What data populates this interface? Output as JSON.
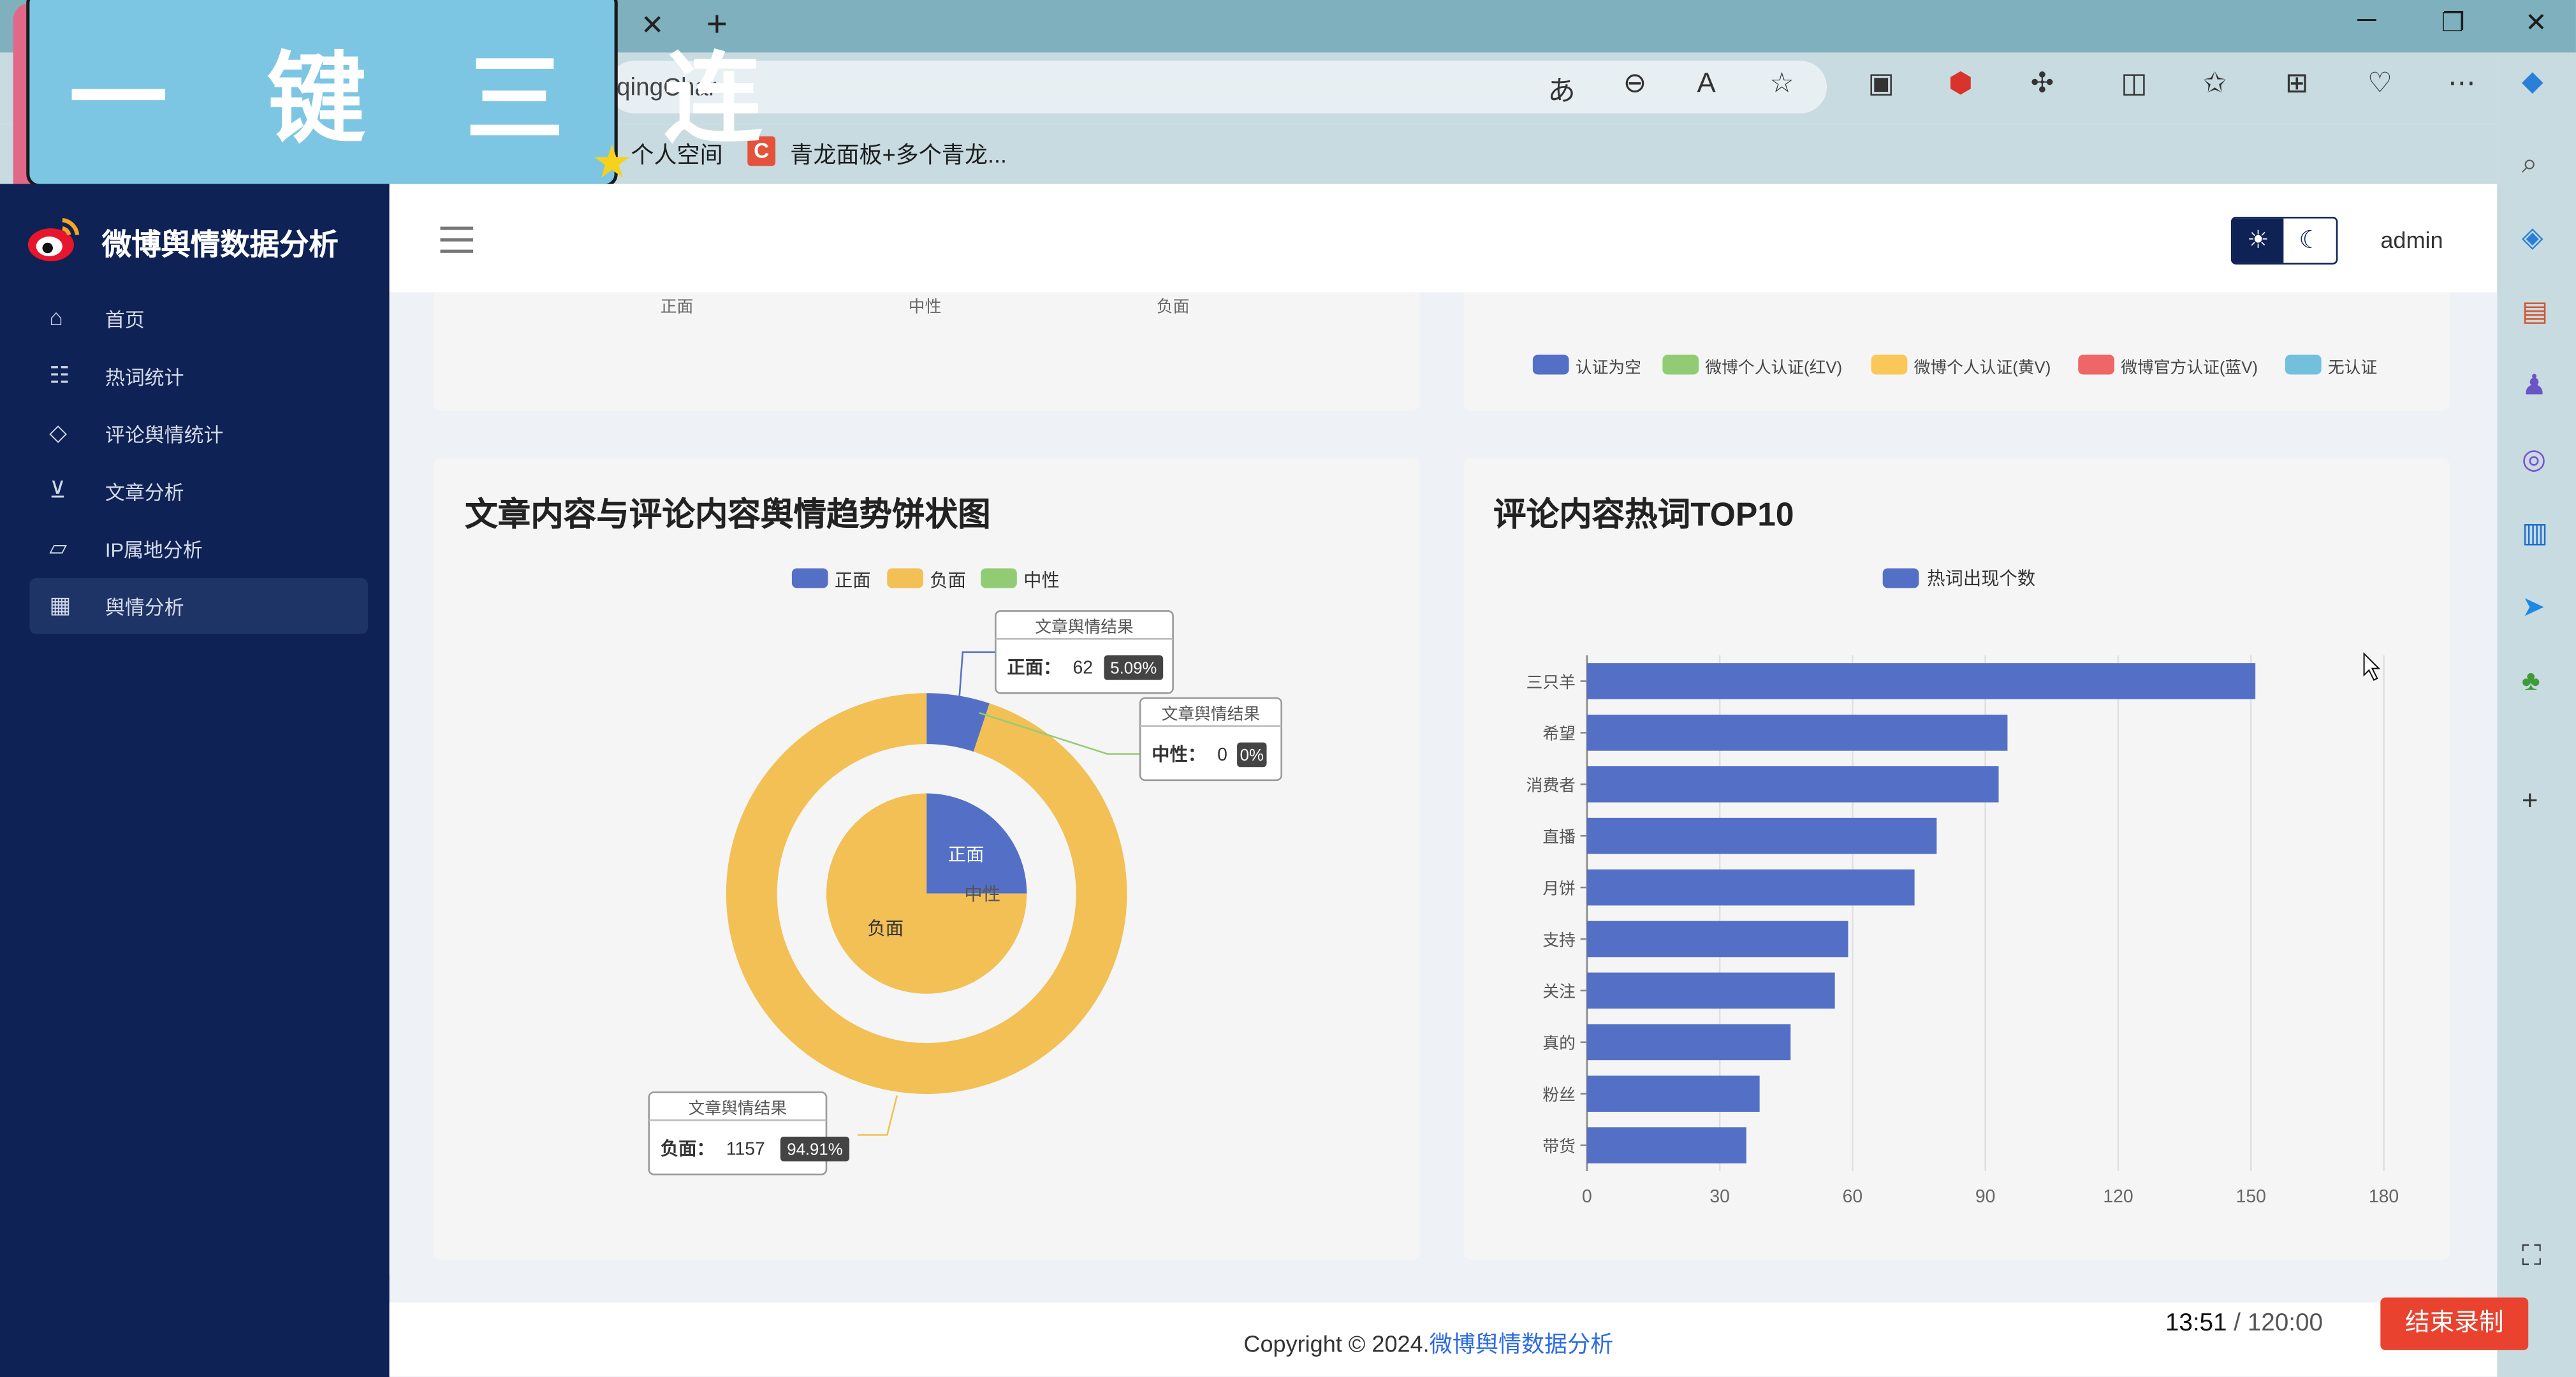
{
  "overlay": {
    "banner_text": "一 键 三 连"
  },
  "browser": {
    "url_fragment": "iqingChar",
    "bookmarks": [
      {
        "label": "个人空间"
      },
      {
        "label": "青龙面板+多个青龙..."
      }
    ],
    "bookmark_icon_letter": "C"
  },
  "app": {
    "title": "微博舆情数据分析",
    "user": "admin",
    "nav": [
      {
        "label": "首页",
        "icon": "home-icon",
        "active": false
      },
      {
        "label": "热词统计",
        "icon": "people-icon",
        "active": false
      },
      {
        "label": "评论舆情统计",
        "icon": "tag-icon",
        "active": false
      },
      {
        "label": "文章分析",
        "icon": "cart-icon",
        "active": false
      },
      {
        "label": "IP属地分析",
        "icon": "chart-icon",
        "active": false
      },
      {
        "label": "舆情分析",
        "icon": "calendar-icon",
        "active": true
      }
    ]
  },
  "top_cards": {
    "left_axis_labels": [
      "正面",
      "中性",
      "负面"
    ],
    "right_legend": [
      {
        "name": "认证为空",
        "color": "#5470c6"
      },
      {
        "name": "微博个人认证(红V)",
        "color": "#91cc75"
      },
      {
        "name": "微博个人认证(黄V)",
        "color": "#fac858"
      },
      {
        "name": "微博官方认证(蓝V)",
        "color": "#ee6666"
      },
      {
        "name": "无认证",
        "color": "#73c0de"
      }
    ]
  },
  "chart_data": [
    {
      "type": "pie",
      "title": "文章内容与评论内容舆情趋势饼状图",
      "legend": [
        {
          "name": "正面",
          "color": "#5470c6"
        },
        {
          "name": "负面",
          "color": "#f2c055"
        },
        {
          "name": "中性",
          "color": "#91cc75"
        }
      ],
      "outer_ring": {
        "slices": [
          {
            "name": "正面",
            "value": 62,
            "percent": "5.09%",
            "color": "#5470c6"
          },
          {
            "name": "中性",
            "value": 0,
            "percent": "0%",
            "color": "#91cc75"
          },
          {
            "name": "负面",
            "value": 1157,
            "percent": "94.91%",
            "color": "#f2c055"
          }
        ]
      },
      "inner_pie": {
        "slices": [
          {
            "name": "正面",
            "fraction": 0.25,
            "color": "#5470c6"
          },
          {
            "name": "中性",
            "fraction": 0.0,
            "color": "#91cc75"
          },
          {
            "name": "负面",
            "fraction": 0.75,
            "color": "#f2c055"
          }
        ]
      },
      "tooltip_title": "文章舆情结果"
    },
    {
      "type": "bar",
      "orientation": "horizontal",
      "title": "评论内容热词TOP10",
      "legend": [
        {
          "name": "热词出现个数",
          "color": "#5470c6"
        }
      ],
      "categories": [
        "三只羊",
        "希望",
        "消费者",
        "直播",
        "月饼",
        "支持",
        "关注",
        "真的",
        "粉丝",
        "带货"
      ],
      "values": [
        151,
        95,
        93,
        79,
        74,
        59,
        56,
        46,
        39,
        36
      ],
      "xlim": [
        0,
        180
      ],
      "xticks": [
        0,
        30,
        60,
        90,
        120,
        150,
        180
      ],
      "color": "#5470c6"
    }
  ],
  "footer": {
    "copyright_prefix": "Copyright © 2024.",
    "copyright_link": "微博舆情数据分析",
    "timer_elapsed": "13:51",
    "timer_total": " / 120:00",
    "record_button": "结束录制"
  }
}
